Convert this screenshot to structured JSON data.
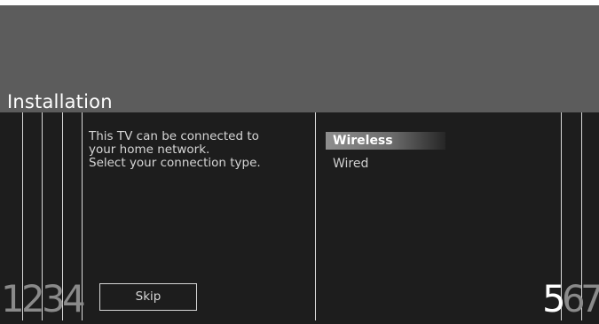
{
  "header": {
    "title": "Installation"
  },
  "main": {
    "description_lines": [
      "This TV can be connected to",
      "your home network.",
      "Select your connection type."
    ],
    "options": [
      {
        "label": "Wireless",
        "selected": true
      },
      {
        "label": "Wired",
        "selected": false
      }
    ],
    "skip_label": "Skip"
  },
  "guides": {
    "left_labels": [
      "1",
      "2",
      "3",
      "4"
    ],
    "right_labels": [
      "5",
      "6",
      "7"
    ]
  },
  "colors": {
    "header_bg": "#5c5c5c",
    "main_bg": "#1d1d1d",
    "highlight": "#8e8e8e"
  }
}
